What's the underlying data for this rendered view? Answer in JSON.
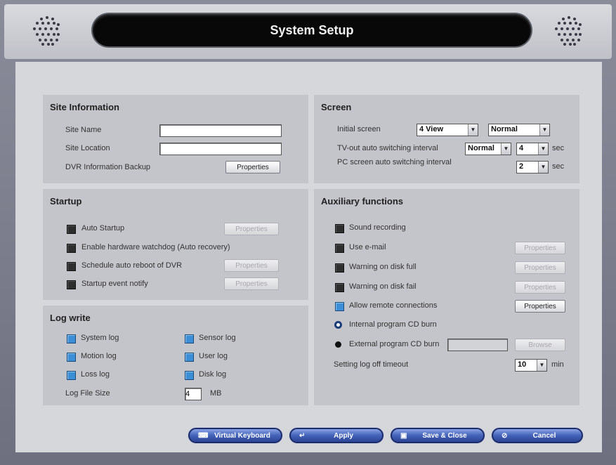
{
  "window": {
    "title": "System Setup"
  },
  "site_information": {
    "title": "Site Information",
    "site_name_label": "Site Name",
    "site_name_value": "",
    "site_location_label": "Site Location",
    "site_location_value": "",
    "backup_label": "DVR Information Backup",
    "properties_label": "Properties"
  },
  "screen": {
    "title": "Screen",
    "initial_label": "Initial screen",
    "initial_view": "4 View",
    "initial_mode": "Normal",
    "tvout_label": "TV-out auto switching interval",
    "tvout_mode": "Normal",
    "tvout_interval": "4",
    "pc_label": "PC screen auto switching interval",
    "pc_interval": "2",
    "sec_label": "sec"
  },
  "startup": {
    "title": "Startup",
    "auto_startup": "Auto Startup",
    "watchdog": "Enable hardware watchdog (Auto recovery)",
    "reboot": "Schedule auto reboot of DVR",
    "event_notify": "Startup event notify",
    "properties_label": "Properties"
  },
  "log_write": {
    "title": "Log write",
    "system_log": "System log",
    "sensor_log": "Sensor log",
    "motion_log": "Motion log",
    "user_log": "User log",
    "loss_log": "Loss log",
    "disk_log": "Disk log",
    "size_label": "Log File Size",
    "size_value": "4",
    "size_unit": "MB"
  },
  "auxiliary": {
    "title": "Auxiliary functions",
    "sound_recording": "Sound recording",
    "use_email": "Use e-mail",
    "disk_full": "Warning on disk full",
    "disk_fail": "Warning on disk fail",
    "remote": "Allow remote connections",
    "internal_cd": "Internal program CD burn",
    "external_cd": "External program CD burn",
    "external_path": "",
    "browse_label": "Browse",
    "logoff_label": "Setting log off timeout",
    "logoff_value": "10",
    "min_label": "min",
    "properties_label": "Properties"
  },
  "buttons": {
    "virtual_keyboard": "Virtual Keyboard",
    "apply": "Apply",
    "save_close": "Save & Close",
    "cancel": "Cancel"
  },
  "colors": {
    "checked": "#3c8fd6",
    "button_blue": "#4362b8",
    "title_bar": "#080808"
  }
}
